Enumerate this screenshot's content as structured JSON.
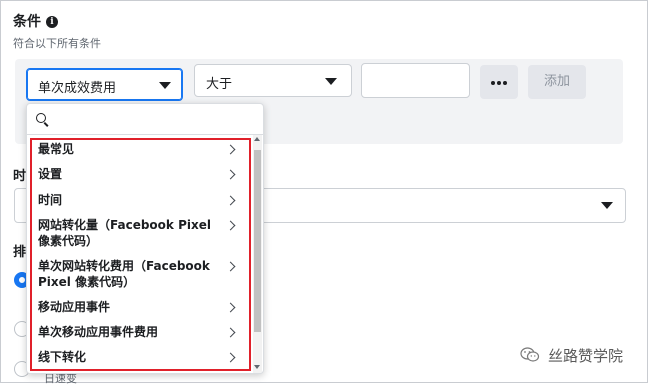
{
  "section": {
    "title": "条件",
    "subtitle": "符合以下所有条件"
  },
  "condition": {
    "metric_value": "单次成效费用",
    "operator_value": "大于",
    "amount_value": "",
    "more_label": "•••",
    "add_label": "添加"
  },
  "background": {
    "time_label": "时",
    "sort_label": "排",
    "trail_text": "。",
    "cutoff_text": "日速变"
  },
  "dropdown": {
    "search_placeholder": "",
    "items": [
      {
        "label": "最常见"
      },
      {
        "label": "设置"
      },
      {
        "label": "时间"
      },
      {
        "label": "网站转化量（Facebook Pixel 像素代码）"
      },
      {
        "label": "单次网站转化费用（Facebook Pixel 像素代码）"
      },
      {
        "label": "移动应用事件"
      },
      {
        "label": "单次移动应用事件费用"
      },
      {
        "label": "线下转化"
      }
    ]
  },
  "watermark": {
    "text": "丝路赞学院"
  },
  "colors": {
    "accent": "#1877f2",
    "highlight": "#e0202a",
    "panel_bg": "#f2f3f5"
  }
}
